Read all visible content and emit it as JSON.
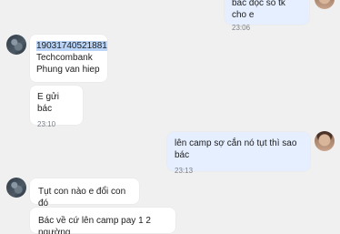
{
  "messages": {
    "top_out": {
      "text": "bác đọc số tk cho e",
      "time": "23:06"
    },
    "bank_info": {
      "account": "19031740521881",
      "bank": "Techcombank",
      "name": "Phung van hiep"
    },
    "send_note": {
      "text": "E gửi bác",
      "time": "23:10"
    },
    "camp_out": {
      "text": "lên camp sợ cắn nó tụt thì sao bác",
      "time": "23:13"
    },
    "swap": {
      "text": "Tụt con nào e đổi con đó"
    },
    "pay": {
      "text": "Bác về cứ lên camp pay 1 2 ngường"
    }
  },
  "colors": {
    "incoming": "#ffffff",
    "outgoing": "#e5efff",
    "background": "#f0f0f0",
    "selection": "#b9d4f7"
  }
}
